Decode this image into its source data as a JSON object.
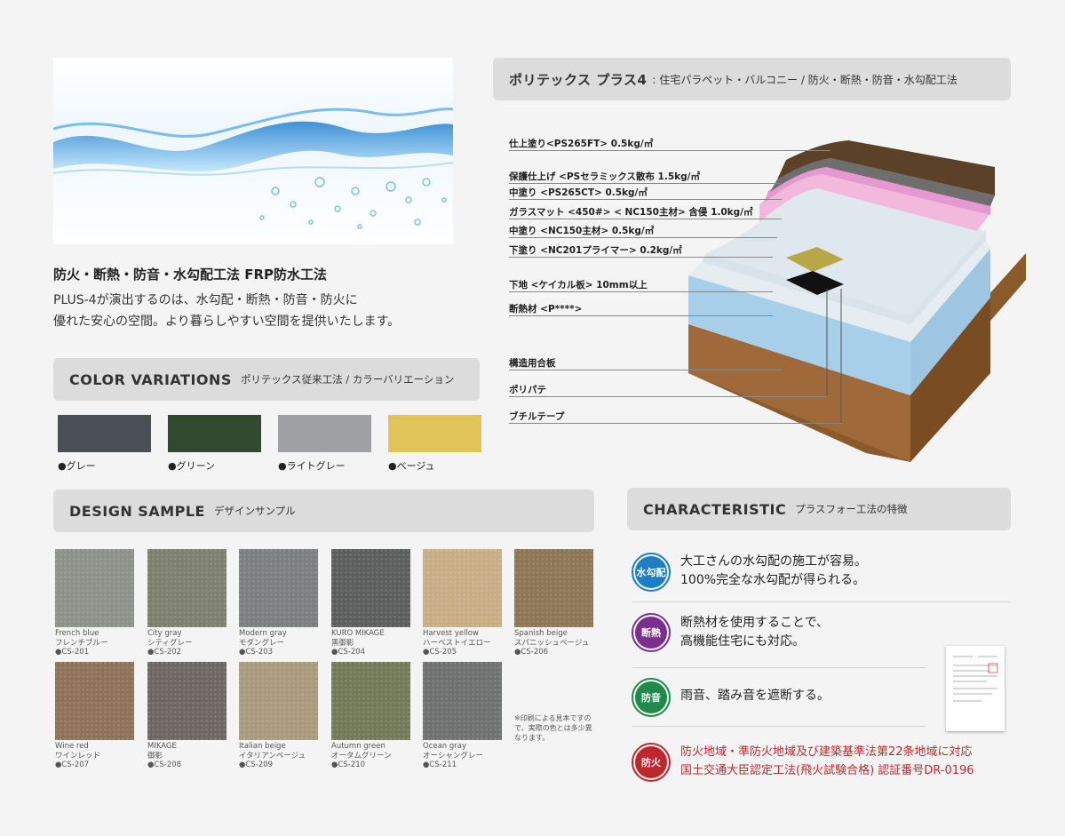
{
  "water_image": {
    "alt": ""
  },
  "intro": {
    "title": "防火・断熱・防音・水勾配工法 FRP防水工法",
    "line1": "PLUS-4が演出するのは、水勾配・断熱・防音・防火に",
    "line2": "優れた安心の空間。より暮らしやすい空間を提供いたします。"
  },
  "color_section": {
    "title": "COLOR VARIATIONS",
    "subtitle": "ポリテックス従来工法 / カラーバリエーション",
    "swatches": [
      {
        "label": "●グレー",
        "color": "#4a4f55"
      },
      {
        "label": "●グリーン",
        "color": "#2f4a2f"
      },
      {
        "label": "●ライトグレー",
        "color": "#9ea0a3"
      },
      {
        "label": "●ベージュ",
        "color": "#e0c457"
      }
    ]
  },
  "design_section": {
    "title": "DESIGN SAMPLE",
    "subtitle": "デザインサンプル",
    "samples": [
      {
        "en": "French blue",
        "ja": "フレンチブルー",
        "code": "●CS-201",
        "color": "#8c918a"
      },
      {
        "en": "City gray",
        "ja": "シティグレー",
        "code": "●CS-202",
        "color": "#7c7f6e"
      },
      {
        "en": "Modern gray",
        "ja": "モダングレー",
        "code": "●CS-203",
        "color": "#7b7e7f"
      },
      {
        "en": "KURO MIKAGE",
        "ja": "黒御影",
        "code": "●CS-204",
        "color": "#5b5d5c"
      },
      {
        "en": "Harvest yellow",
        "ja": "ハーベストイエロー",
        "code": "●CS-205",
        "color": "#c7ae87"
      },
      {
        "en": "Spanish beige",
        "ja": "スパニッシュベージュ",
        "code": "●CS-206",
        "color": "#8d7553"
      },
      {
        "en": "Wine red",
        "ja": "ワインレッド",
        "code": "●CS-207",
        "color": "#8e7257"
      },
      {
        "en": "MIKAGE",
        "ja": "御影",
        "code": "●CS-208",
        "color": "#6d6562"
      },
      {
        "en": "Italian beige",
        "ja": "イタリアンベージュ",
        "code": "●CS-209",
        "color": "#a99a7c"
      },
      {
        "en": "Autumn green",
        "ja": "オータムグリーン",
        "code": "●CS-210",
        "color": "#727a58"
      },
      {
        "en": "Ocean gray",
        "ja": "オーシャングレー",
        "code": "●CS-211",
        "color": "#6e7170"
      }
    ],
    "note": "※印刷による見本ですので、実際の色とは多少異なります。"
  },
  "diagram": {
    "title": "ポリテックス プラス4",
    "subtitle": ": 住宅パラペット・バルコニー / 防火・断熱・防音・水勾配工法",
    "layers": [
      "仕上塗り<PS265FT> 0.5kg/㎡",
      "保護仕上げ <PSセラミックス散布 1.5kg/㎡",
      "中塗り <PS265CT> 0.5kg/㎡",
      "ガラスマット <450#> < NC150主材> 含侵 1.0kg/㎡",
      "中塗り <NC150主材> 0.5kg/㎡",
      "下塗り <NC201プライマー> 0.2kg/㎡",
      "下地 <ケイカル板> 10mm以上",
      "断熱材 <P****>",
      "構造用合板",
      "ポリパテ",
      "ブチルテープ"
    ]
  },
  "characteristic": {
    "title": "CHARACTERISTIC",
    "subtitle": "プラスフォー工法の特徴",
    "items": [
      {
        "badge": "水勾配",
        "color": "#1d7fc1",
        "line1": "大工さんの水勾配の施工が容易。",
        "line2": "100%完全な水勾配が得られる。"
      },
      {
        "badge": "断熱",
        "color": "#7a2f8f",
        "line1": "断熱材を使用することで、",
        "line2": "高機能住宅にも対応。"
      },
      {
        "badge": "防音",
        "color": "#1f8a4a",
        "line1": "雨音、踏み音を遮断する。",
        "line2": ""
      },
      {
        "badge": "防火",
        "color": "#c0272d",
        "line1": "防火地域・準防火地域及び建築基準法第22条地域に対応",
        "line2": "国土交通大臣認定工法(飛火試験合格) 認証番号DR-0196"
      }
    ]
  }
}
